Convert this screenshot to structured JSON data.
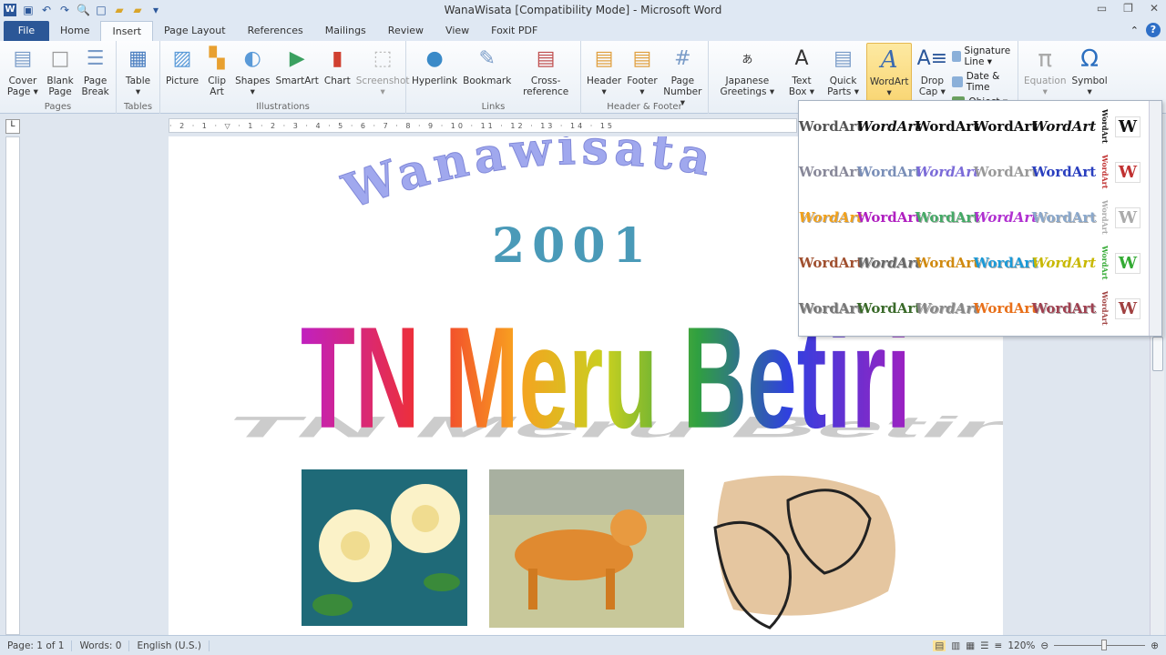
{
  "window": {
    "title": "WanaWisata [Compatibility Mode] - Microsoft Word",
    "minimize": "▭",
    "restore": "❐",
    "close": "✕"
  },
  "quick_access": [
    "word-logo",
    "save",
    "undo",
    "redo",
    "print-preview",
    "new",
    "open",
    "folder"
  ],
  "tabs": [
    {
      "label": "File"
    },
    {
      "label": "Home"
    },
    {
      "label": "Insert",
      "active": true
    },
    {
      "label": "Page Layout"
    },
    {
      "label": "References"
    },
    {
      "label": "Mailings"
    },
    {
      "label": "Review"
    },
    {
      "label": "View"
    },
    {
      "label": "Foxit PDF"
    }
  ],
  "ribbon": {
    "pages": {
      "label": "Pages",
      "buttons": [
        "Cover Page ▾",
        "Blank Page",
        "Page Break"
      ]
    },
    "tables": {
      "label": "Tables",
      "buttons": [
        "Table ▾"
      ]
    },
    "illustrations": {
      "label": "Illustrations",
      "buttons": [
        "Picture",
        "Clip Art",
        "Shapes ▾",
        "SmartArt",
        "Chart",
        "Screenshot ▾"
      ]
    },
    "links": {
      "label": "Links",
      "buttons": [
        "Hyperlink",
        "Bookmark",
        "Cross-reference"
      ]
    },
    "header_footer": {
      "label": "Header & Footer",
      "buttons": [
        "Header ▾",
        "Footer ▾",
        "Page Number ▾"
      ]
    },
    "text": {
      "buttons": [
        "Japanese Greetings ▾",
        "Text Box ▾",
        "Quick Parts ▾",
        "WordArt ▾",
        "Drop Cap ▾"
      ],
      "small": [
        "Signature Line ▾",
        "Date & Time",
        "Object ▾"
      ]
    },
    "symbols": {
      "buttons": [
        "Equation ▾",
        "Symbol ▾"
      ]
    }
  },
  "document": {
    "line1": "Wanawisata",
    "line2": "2001",
    "headline": "TN Meru Betiri",
    "images": [
      "roses-clipart",
      "tiger-clipart",
      "leaves-clipart"
    ]
  },
  "wordart_gallery": {
    "sample": "WordArt",
    "vertical_sample": "W",
    "styles": [
      "#555",
      "#111",
      "#111",
      "#111",
      "#111",
      "#889",
      "#7a8fb8",
      "#7b6bd8",
      "#999",
      "#2a3fbf",
      "#f2a11a",
      "#b020c0",
      "#4a6",
      "#b030d0",
      "#8aa8cc",
      "#a05030",
      "#666",
      "#d08a10",
      "#1a9ad8",
      "#c8b800",
      "#777",
      "#3a6a2a",
      "#888",
      "#e8701a",
      "#a04050"
    ]
  },
  "status": {
    "page": "Page: 1 of 1",
    "words": "Words: 0",
    "language": "English (U.S.)",
    "zoom": "120%",
    "zoom_percent": 120
  },
  "colors": {
    "accent": "#2b5797",
    "selected": "#f8d26b"
  }
}
